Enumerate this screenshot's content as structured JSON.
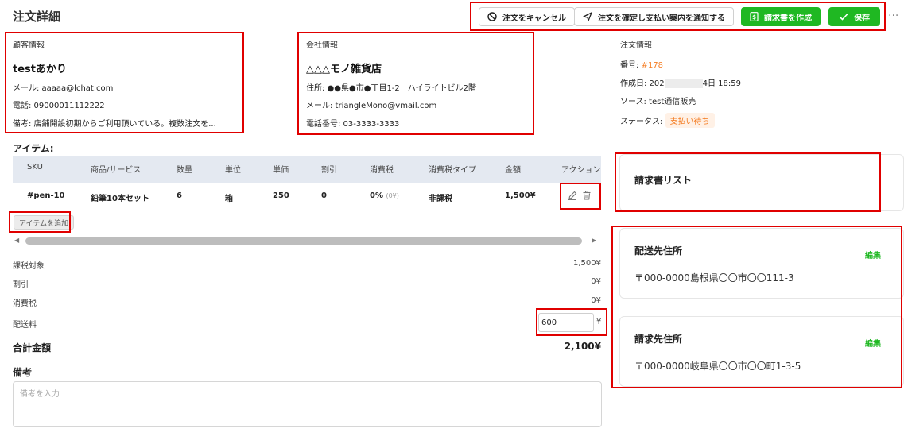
{
  "header": {
    "title": "注文詳細",
    "cancel_label": "注文をキャンセル",
    "confirm_label": "注文を確定し支払い案内を通知する",
    "invoice_label": "請求書を作成",
    "save_label": "保存",
    "more_label": "···"
  },
  "customer": {
    "section_title": "顧客情報",
    "name": "testあかり",
    "email": "メール: aaaaa@lchat.com",
    "phone": "電話: 09000011112222",
    "note": "備考: 店舗開設初期からご利用頂いている。複数注文を..."
  },
  "company": {
    "section_title": "会社情報",
    "name": "△△△モノ雑貨店",
    "address": "住所: ●●県●市●丁目1-2　ハイライトビル2階",
    "email": "メール: triangleMono@vmail.com",
    "phone": "電話番号: 03-3333-3333"
  },
  "order": {
    "section_title": "注文情報",
    "number_label": "番号:",
    "number_value": "#178",
    "created_label": "作成日: 202",
    "created_time": "4日 18:59",
    "source": "ソース: test通信販売",
    "status_label": "ステータス:",
    "status_value": "支払い待ち"
  },
  "items": {
    "section_title": "アイテム:",
    "columns": [
      "SKU",
      "商品/サービス",
      "数量",
      "単位",
      "単価",
      "割引",
      "消費税",
      "消費税タイプ",
      "金額",
      "アクション"
    ],
    "rows": [
      {
        "sku": "#pen-10",
        "product": "鉛筆10本セット",
        "qty": "6",
        "unit": "箱",
        "price": "250",
        "discount": "0",
        "tax": "0%",
        "tax_amount": "(0¥)",
        "tax_type": "非課税",
        "amount": "1,500¥"
      }
    ],
    "add_label": "アイテムを追加"
  },
  "totals": {
    "taxable_label": "課税対象",
    "taxable_value": "1,500¥",
    "discount_label": "割引",
    "discount_value": "0¥",
    "tax_label": "消費税",
    "tax_value": "0¥",
    "shipping_label": "配送料",
    "shipping_value": "600",
    "shipping_unit": "¥",
    "total_label": "合計金額",
    "total_value": "2,100¥"
  },
  "memo": {
    "label": "備考",
    "placeholder": "備考を入力"
  },
  "invoice_list": {
    "title": "請求書リスト"
  },
  "shipping_address": {
    "title": "配送先住所",
    "edit_label": "編集",
    "address": "〒000-0000島根県〇〇市〇〇111-3"
  },
  "billing_address": {
    "title": "請求先住所",
    "edit_label": "編集",
    "address": "〒000-0000岐阜県〇〇市〇〇町1-3-5"
  },
  "colors": {
    "accent_green": "#1fb822",
    "accent_orange": "#f47b20",
    "highlight_red": "#e00000",
    "table_header": "#e4e9f1"
  }
}
